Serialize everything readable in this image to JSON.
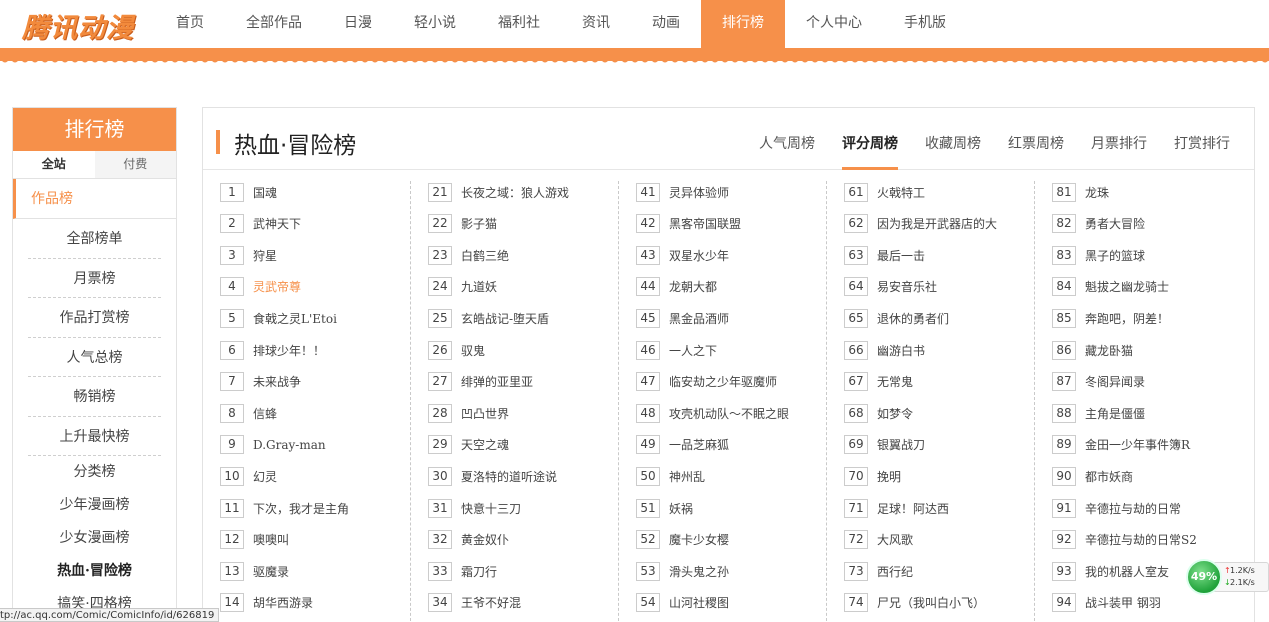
{
  "logo": "腾讯动漫",
  "nav": [
    "首页",
    "全部作品",
    "日漫",
    "轻小说",
    "福利社",
    "资讯",
    "动画",
    "排行榜",
    "个人中心",
    "手机版"
  ],
  "nav_active": "排行榜",
  "sidebar": {
    "title": "排行榜",
    "tabs": [
      "全站",
      "付费"
    ],
    "section": "作品榜",
    "items": [
      "全部榜单",
      "月票榜",
      "作品打赏榜",
      "人气总榜",
      "畅销榜",
      "上升最快榜"
    ],
    "categories": [
      "分类榜",
      "少年漫画榜",
      "少女漫画榜",
      "热血·冒险榜",
      "搞笑·四格榜"
    ],
    "active_category": "热血·冒险榜"
  },
  "main": {
    "title": "热血·冒险榜",
    "tabs": [
      "人气周榜",
      "评分周榜",
      "收藏周榜",
      "红票周榜",
      "月票排行",
      "打赏排行"
    ],
    "active_tab": "评分周榜",
    "columns": [
      [
        {
          "rank": "1",
          "title": "国魂"
        },
        {
          "rank": "2",
          "title": "武神天下"
        },
        {
          "rank": "3",
          "title": "狩星"
        },
        {
          "rank": "4",
          "title": "灵武帝尊"
        },
        {
          "rank": "5",
          "title": "食戟之灵L'Etoi"
        },
        {
          "rank": "6",
          "title": "排球少年！！"
        },
        {
          "rank": "7",
          "title": "未来战争"
        },
        {
          "rank": "8",
          "title": "信蜂"
        },
        {
          "rank": "9",
          "title": "D.Gray-man"
        },
        {
          "rank": "10",
          "title": "幻灵"
        },
        {
          "rank": "11",
          "title": "下次，我才是主角"
        },
        {
          "rank": "12",
          "title": "噢噢叫"
        },
        {
          "rank": "13",
          "title": "驱魔录"
        },
        {
          "rank": "14",
          "title": "胡华西游录"
        }
      ],
      [
        {
          "rank": "21",
          "title": "长夜之域：狼人游戏"
        },
        {
          "rank": "22",
          "title": "影子猫"
        },
        {
          "rank": "23",
          "title": "白鹤三绝"
        },
        {
          "rank": "24",
          "title": "九道妖"
        },
        {
          "rank": "25",
          "title": "玄皓战记-堕天盾"
        },
        {
          "rank": "26",
          "title": "驭鬼"
        },
        {
          "rank": "27",
          "title": "绯弹的亚里亚"
        },
        {
          "rank": "28",
          "title": "凹凸世界"
        },
        {
          "rank": "29",
          "title": "天空之魂"
        },
        {
          "rank": "30",
          "title": "夏洛特的道听途说"
        },
        {
          "rank": "31",
          "title": "快意十三刀"
        },
        {
          "rank": "32",
          "title": "黄金奴仆"
        },
        {
          "rank": "33",
          "title": "霜刀行"
        },
        {
          "rank": "34",
          "title": "王爷不好混"
        }
      ],
      [
        {
          "rank": "41",
          "title": "灵异体验师"
        },
        {
          "rank": "42",
          "title": "黑客帝国联盟"
        },
        {
          "rank": "43",
          "title": "双星水少年"
        },
        {
          "rank": "44",
          "title": "龙朝大都"
        },
        {
          "rank": "45",
          "title": "黑金品酒师"
        },
        {
          "rank": "46",
          "title": "一人之下"
        },
        {
          "rank": "47",
          "title": "临安劫之少年驱魔师"
        },
        {
          "rank": "48",
          "title": "攻壳机动队～不眠之眼"
        },
        {
          "rank": "49",
          "title": "一品芝麻狐"
        },
        {
          "rank": "50",
          "title": "神州乱"
        },
        {
          "rank": "51",
          "title": "妖祸"
        },
        {
          "rank": "52",
          "title": "魔卡少女樱"
        },
        {
          "rank": "53",
          "title": "滑头鬼之孙"
        },
        {
          "rank": "54",
          "title": "山河社稷图"
        }
      ],
      [
        {
          "rank": "61",
          "title": "火戟特工"
        },
        {
          "rank": "62",
          "title": "因为我是开武器店的大"
        },
        {
          "rank": "63",
          "title": "最后一击"
        },
        {
          "rank": "64",
          "title": "易安音乐社"
        },
        {
          "rank": "65",
          "title": "退休的勇者们"
        },
        {
          "rank": "66",
          "title": "幽游白书"
        },
        {
          "rank": "67",
          "title": "无常鬼"
        },
        {
          "rank": "68",
          "title": "如梦令"
        },
        {
          "rank": "69",
          "title": "银翼战刀"
        },
        {
          "rank": "70",
          "title": "挽明"
        },
        {
          "rank": "71",
          "title": "足球！阿达西"
        },
        {
          "rank": "72",
          "title": "大风歌"
        },
        {
          "rank": "73",
          "title": "西行纪"
        },
        {
          "rank": "74",
          "title": "尸兄（我叫白小飞）"
        }
      ],
      [
        {
          "rank": "81",
          "title": "龙珠"
        },
        {
          "rank": "82",
          "title": "勇者大冒险"
        },
        {
          "rank": "83",
          "title": "黑子的篮球"
        },
        {
          "rank": "84",
          "title": "魁拔之幽龙骑士"
        },
        {
          "rank": "85",
          "title": "奔跑吧，阴差！"
        },
        {
          "rank": "86",
          "title": "藏龙卧猫"
        },
        {
          "rank": "87",
          "title": "冬阁异闻录"
        },
        {
          "rank": "88",
          "title": "主角是僵僵"
        },
        {
          "rank": "89",
          "title": "金田一少年事件簿R"
        },
        {
          "rank": "90",
          "title": "都市妖商"
        },
        {
          "rank": "91",
          "title": "辛德拉与劫的日常"
        },
        {
          "rank": "92",
          "title": "辛德拉与劫的日常S2"
        },
        {
          "rank": "93",
          "title": "我的机器人室友"
        },
        {
          "rank": "94",
          "title": "战斗装甲 钢羽"
        }
      ]
    ],
    "highlight": "灵武帝尊"
  },
  "statusbar": "tp://ac.qq.com/Comic/ComicInfo/id/626819",
  "net_widget": {
    "percent": "49%",
    "up": "1.2K/s",
    "down": "2.1K/s"
  },
  "colors": {
    "accent": "#f6904a"
  }
}
